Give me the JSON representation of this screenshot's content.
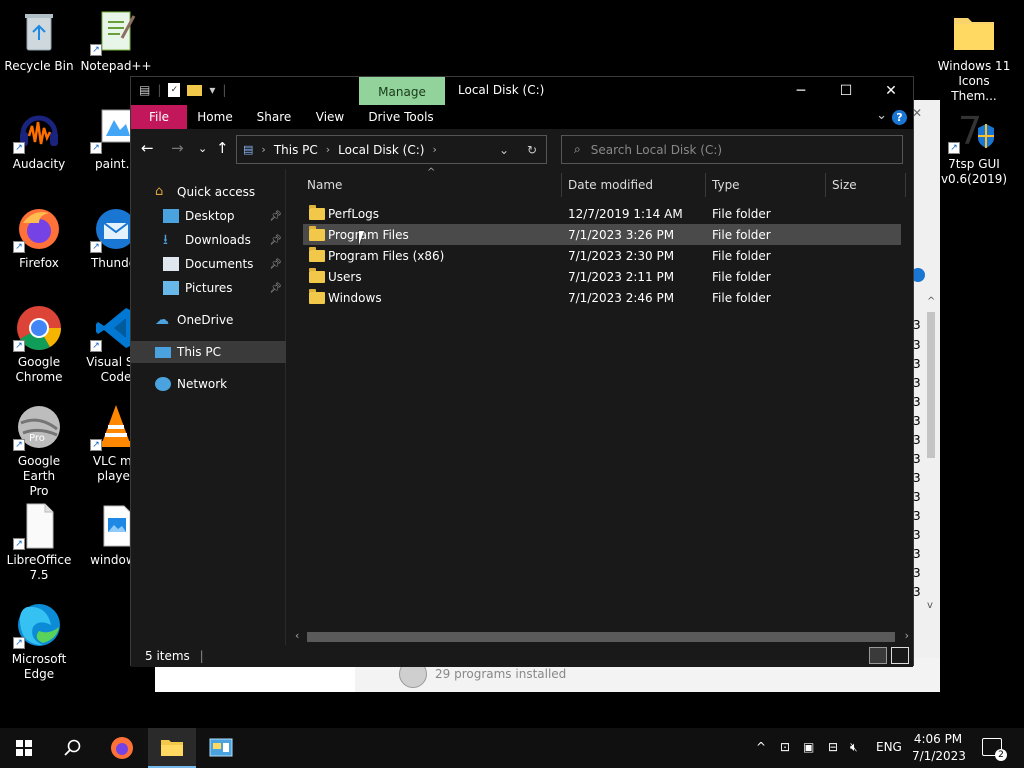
{
  "desktop": {
    "icons": [
      {
        "label": "Recycle Bin"
      },
      {
        "label": "Notepad++"
      },
      {
        "label": "Audacity"
      },
      {
        "label": "paint.n"
      },
      {
        "label": "Firefox"
      },
      {
        "label": "Thunder"
      },
      {
        "label": "Google\nChrome"
      },
      {
        "label": "Visual Stu\nCode"
      },
      {
        "label": "Google Earth\nPro"
      },
      {
        "label": "VLC me\nplayer"
      },
      {
        "label": "LibreOffice\n7.5"
      },
      {
        "label": "windows"
      },
      {
        "label": "Microsoft\nEdge"
      },
      {
        "label": "Windows 11\nIcons Them..."
      },
      {
        "label": "7tsp GUI\nv0.6(2019)"
      }
    ],
    "earth_badge": "Pro"
  },
  "back_window": {
    "row_digit": "3",
    "footer_text": "29 programs installed"
  },
  "explorer": {
    "manage_tab": "Manage",
    "title": "Local Disk (C:)",
    "ribbon_tabs": [
      "File",
      "Home",
      "Share",
      "View",
      "Drive Tools"
    ],
    "breadcrumb": [
      "This PC",
      "Local Disk (C:)"
    ],
    "search_placeholder": "Search Local Disk (C:)",
    "nav": {
      "quick_access": "Quick access",
      "desktop": "Desktop",
      "downloads": "Downloads",
      "documents": "Documents",
      "pictures": "Pictures",
      "onedrive": "OneDrive",
      "this_pc": "This PC",
      "network": "Network"
    },
    "columns": [
      "Name",
      "Date modified",
      "Type",
      "Size"
    ],
    "files": [
      {
        "name": "PerfLogs",
        "date": "12/7/2019 1:14 AM",
        "type": "File folder"
      },
      {
        "name": "Program Files",
        "date": "7/1/2023 3:26 PM",
        "type": "File folder"
      },
      {
        "name": "Program Files (x86)",
        "date": "7/1/2023 2:30 PM",
        "type": "File folder"
      },
      {
        "name": "Users",
        "date": "7/1/2023 2:11 PM",
        "type": "File folder"
      },
      {
        "name": "Windows",
        "date": "7/1/2023 2:46 PM",
        "type": "File folder"
      }
    ],
    "status": "5 items"
  },
  "taskbar": {
    "language": "ENG",
    "time": "4:06 PM",
    "date": "7/1/2023",
    "notification_count": "2"
  },
  "colors": {
    "file_tab": "#c2185b",
    "manage_tab": "#92d39b",
    "folder": "#f2c84b",
    "accent": "#76b9ed"
  }
}
